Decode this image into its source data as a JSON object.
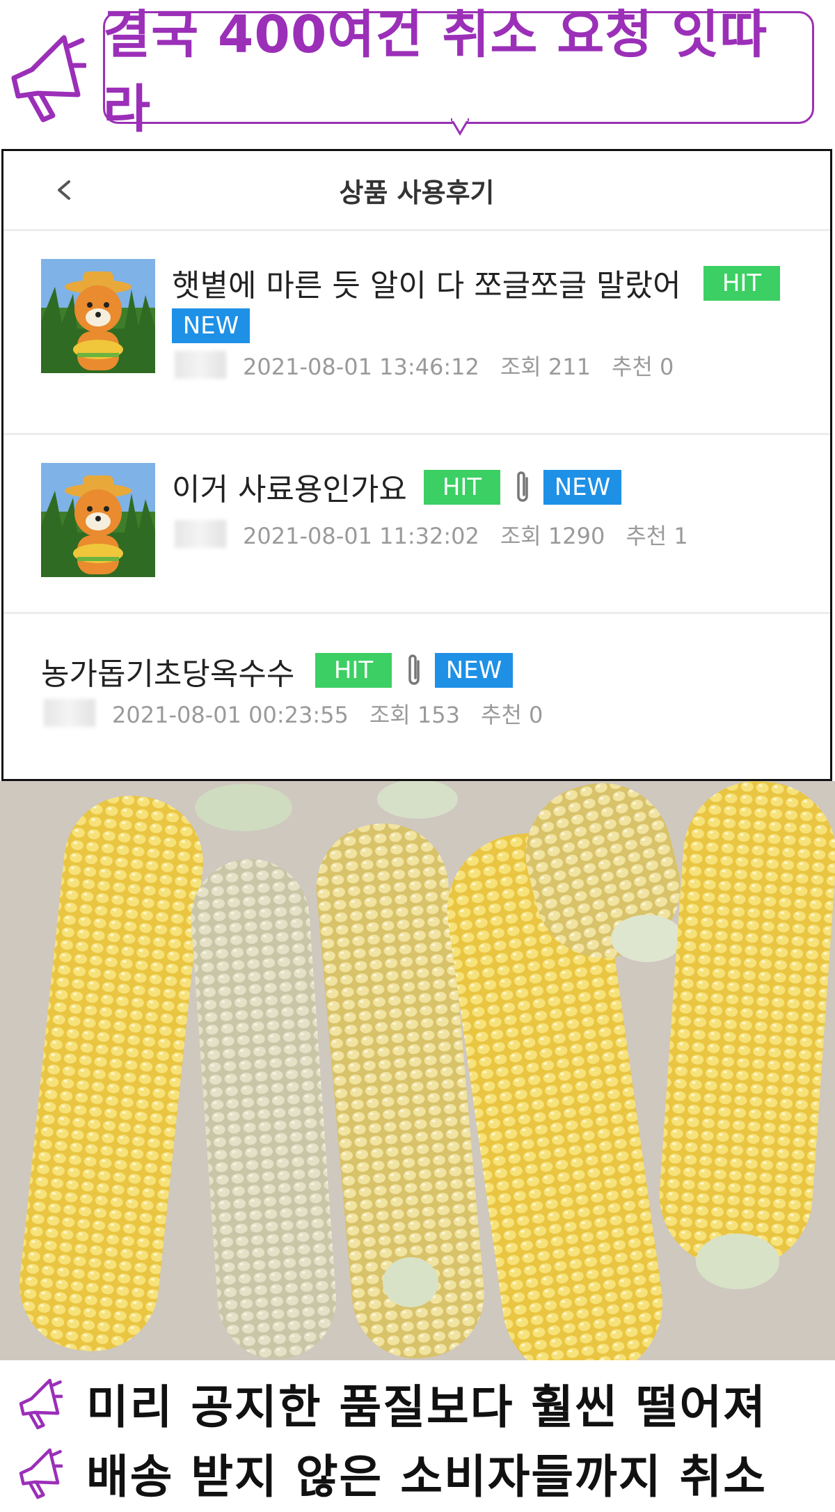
{
  "headline": {
    "text": "결국 400여건 취소 요청 잇따라",
    "color": "#9b2fb8"
  },
  "panel": {
    "title": "상품 사용후기",
    "posts": [
      {
        "title": "햇볕에 마른 듯 알이 다 쪼글쪼글 말랐어",
        "tags": [
          "HIT",
          "NEW"
        ],
        "attachment": false,
        "date": "2021-08-01 13:46:12",
        "views": "조회 211",
        "recommend": "추천 0"
      },
      {
        "title": "이거 사료용인가요",
        "tags": [
          "HIT",
          "NEW"
        ],
        "attachment": true,
        "date": "2021-08-01 11:32:02",
        "views": "조회 1290",
        "recommend": "추천 1"
      },
      {
        "title": "농가돕기초당옥수수",
        "tags": [
          "HIT",
          "NEW"
        ],
        "attachment": true,
        "date": "2021-08-01 00:23:55",
        "views": "조회 153",
        "recommend": "추천 0"
      }
    ],
    "colors": {
      "hit": "#3ccf63",
      "new": "#1e90e6"
    }
  },
  "captions": [
    "미리 공지한 품질보다 훨씬 떨어져",
    "배송 받지 않은 소비자들까지 취소"
  ],
  "icons": [
    "megaphone-icon",
    "back-chevron-icon",
    "paperclip-icon"
  ]
}
